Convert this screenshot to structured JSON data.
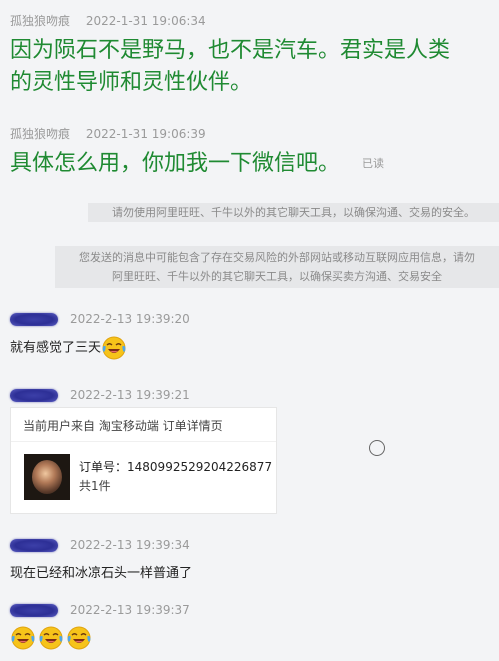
{
  "messages": [
    {
      "sender": "孤独狼吻痕",
      "time": "2022-1-31 19:06:34",
      "lines": [
        "因为陨石不是野马，也不是汽车。君实是人类",
        "的灵性导师和灵性伙伴。"
      ]
    },
    {
      "sender": "孤独狼吻痕",
      "time": "2022-1-31 19:06:39",
      "text": "具体怎么用，你加我一下微信吧。",
      "read_status": "已读"
    }
  ],
  "notices": [
    "请勿使用阿里旺旺、千牛以外的其它聊天工具，以确保沟通、交易的安全。",
    "您发送的消息中可能包含了存在交易风险的外部网站或移动互联网应用信息，请勿",
    "阿里旺旺、千牛以外的其它聊天工具，以确保买卖方沟通、交易安全"
  ],
  "buyer_messages": [
    {
      "time": "2022-2-13 19:39:20",
      "text": "就有感觉了三天",
      "emoji": "laughing-tears-emoji"
    },
    {
      "time": "2022-2-13 19:39:21"
    },
    {
      "time": "2022-2-13 19:39:34",
      "text": "现在已经和冰凉石头一样普通了"
    },
    {
      "time": "2022-2-13 19:39:37",
      "emoji_count": 3,
      "emoji": "laughing-tears-emoji"
    }
  ],
  "order_card": {
    "header": "当前用户来自 淘宝移动端 订单详情页",
    "order_label": "订单号：",
    "order_number": "1480992529204226877",
    "quantity": "共1件"
  },
  "colors": {
    "seller_text": "#1f8a32",
    "meta_text": "#9a9a9a",
    "notice_bg": "#e6e7e9",
    "blurred_name": "#2d2f96",
    "page_bg": "#f3f4f6"
  }
}
